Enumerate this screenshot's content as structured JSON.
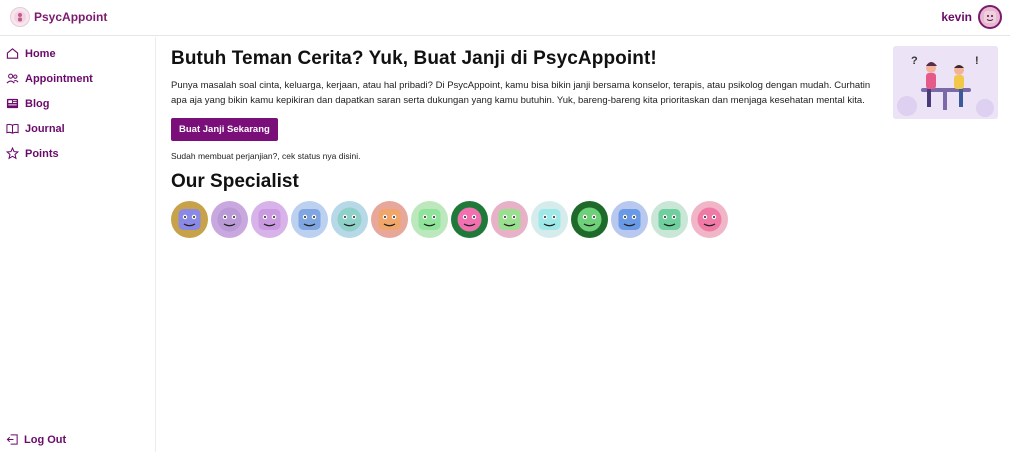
{
  "app": {
    "name": "PsycAppoint"
  },
  "user": {
    "name": "kevin"
  },
  "sidebar": {
    "items": [
      {
        "label": "Home",
        "icon": "home-icon"
      },
      {
        "label": "Appointment",
        "icon": "users-icon"
      },
      {
        "label": "Blog",
        "icon": "blog-icon"
      },
      {
        "label": "Journal",
        "icon": "book-icon"
      },
      {
        "label": "Points",
        "icon": "star-icon"
      }
    ],
    "logout_label": "Log Out"
  },
  "main": {
    "headline": "Butuh Teman Cerita? Yuk, Buat Janji di PsycAppoint!",
    "description": "Punya masalah soal cinta, keluarga, kerjaan, atau hal pribadi? Di PsycAppoint, kamu bisa bikin janji bersama konselor, terapis, atau psikolog dengan mudah. Curhatin apa aja yang bikin kamu kepikiran dan dapatkan saran serta dukungan yang kamu butuhin. Yuk, bareng-bareng kita prioritaskan dan menjaga kesehatan mental kita.",
    "cta_label": "Buat Janji Sekarang",
    "status_text": "Sudah membuat perjanjian?, cek status nya disini.",
    "specialists_title": "Our Specialist"
  },
  "colors": {
    "accent": "#7b0f7a",
    "specialist_bg": [
      "#c7a24a",
      "#c9a7df",
      "#d7b3ea",
      "#bcd0ef",
      "#b7d8e6",
      "#e7a79b",
      "#bde8bd",
      "#1f7a3a",
      "#e7b2c7",
      "#d6ecec",
      "#1f6a2a",
      "#b9c8ef",
      "#c9e6d6",
      "#f0b6c7"
    ],
    "specialist_face": [
      "#8a8ae6",
      "#b99ad7",
      "#c99ae0",
      "#7fa6e0",
      "#8fd1c9",
      "#f0a66a",
      "#8fe39a",
      "#f070b0",
      "#9adf8f",
      "#9fe8e8",
      "#6fd07a",
      "#6a9ae6",
      "#6fcf9f",
      "#f07aa6"
    ]
  }
}
